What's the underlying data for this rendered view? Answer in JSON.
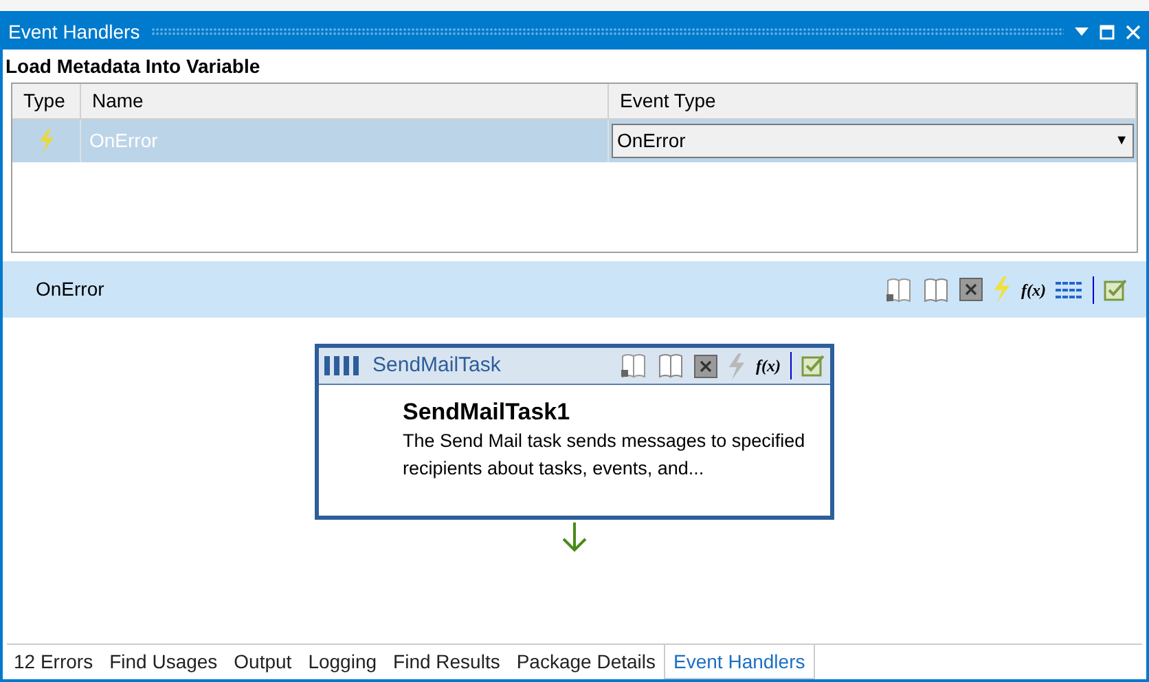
{
  "window": {
    "title": "Event Handlers"
  },
  "executable": "Load Metadata Into Variable",
  "grid": {
    "columns": [
      "Type",
      "Name",
      "Event Type"
    ],
    "rows": [
      {
        "name": "OnError",
        "event_type": "OnError",
        "dropdown_arrow": "▼",
        "selected": true
      }
    ]
  },
  "event_bar": {
    "label": "OnError",
    "tools": [
      {
        "kind": "book"
      },
      {
        "kind": "openbook"
      },
      {
        "kind": "variable"
      },
      {
        "kind": "bolt",
        "disabled": false
      },
      {
        "kind": "fx",
        "text": "f(x)"
      },
      {
        "kind": "lines"
      },
      {
        "kind": "sep"
      },
      {
        "kind": "check"
      }
    ]
  },
  "task": {
    "type": "SendMailTask",
    "name": "SendMailTask1",
    "description": "The Send Mail task sends messages to specified recipients about tasks, events, and...",
    "tools": [
      {
        "kind": "book"
      },
      {
        "kind": "openbook"
      },
      {
        "kind": "variable"
      },
      {
        "kind": "bolt",
        "disabled": true
      },
      {
        "kind": "fx",
        "text": "f(x)"
      },
      {
        "kind": "sep"
      },
      {
        "kind": "check"
      }
    ]
  },
  "tabs": [
    {
      "label": "12 Errors",
      "selected": false
    },
    {
      "label": "Find Usages",
      "selected": false
    },
    {
      "label": "Output",
      "selected": false
    },
    {
      "label": "Logging",
      "selected": false
    },
    {
      "label": "Find Results",
      "selected": false
    },
    {
      "label": "Package Details",
      "selected": false
    },
    {
      "label": "Event Handlers",
      "selected": true
    }
  ]
}
